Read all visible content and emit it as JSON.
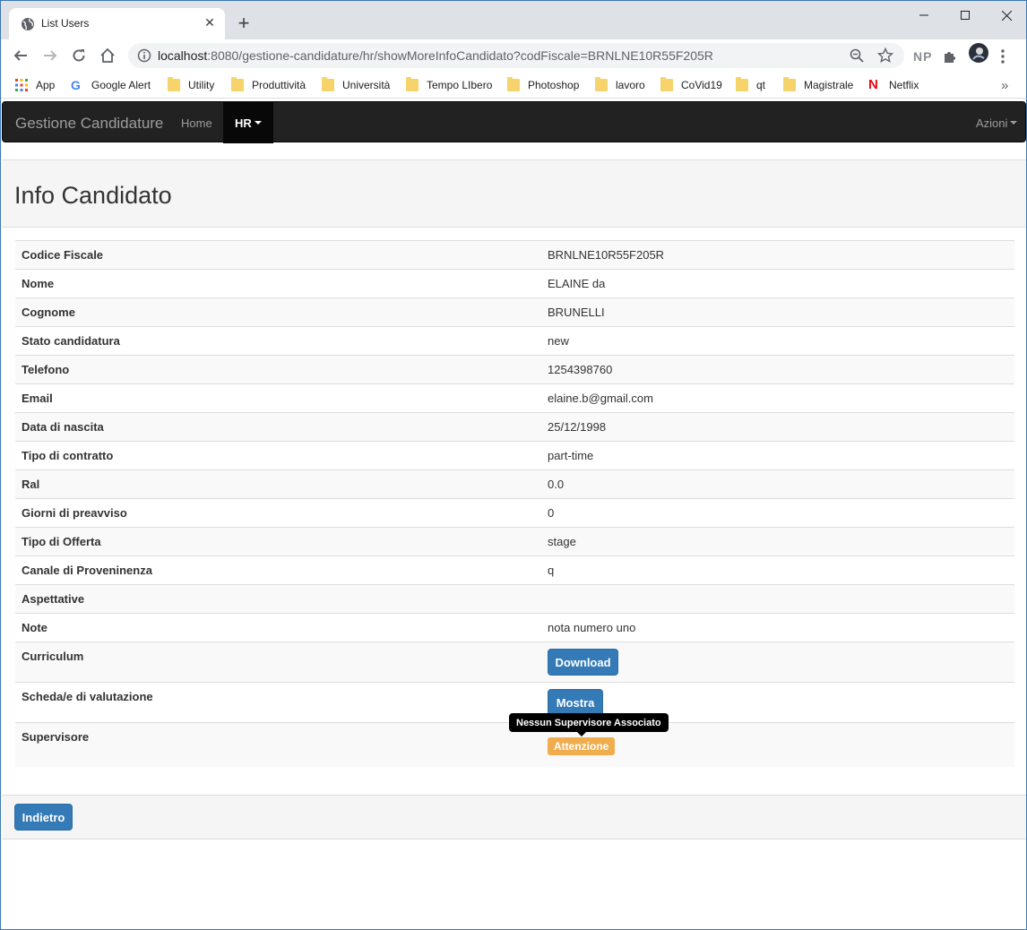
{
  "browser": {
    "tab_title": "List Users",
    "url_host": "localhost",
    "url_rest": ":8080/gestione-candidature/hr/showMoreInfoCandidato?codFiscale=BRNLNE10R55F205R",
    "extension_np": "NP",
    "bookmarks": [
      {
        "label": "App",
        "icon": "apps-grid-icon"
      },
      {
        "label": "Google Alert",
        "icon": "google-icon"
      },
      {
        "label": "Utility",
        "icon": "folder-icon"
      },
      {
        "label": "Produttività",
        "icon": "folder-icon"
      },
      {
        "label": "Università",
        "icon": "folder-icon"
      },
      {
        "label": "Tempo LIbero",
        "icon": "folder-icon"
      },
      {
        "label": "Photoshop",
        "icon": "folder-icon"
      },
      {
        "label": "lavoro",
        "icon": "folder-icon"
      },
      {
        "label": "CoVid19",
        "icon": "folder-icon"
      },
      {
        "label": "qt",
        "icon": "folder-icon"
      },
      {
        "label": "Magistrale",
        "icon": "folder-icon"
      },
      {
        "label": "Netflix",
        "icon": "netflix-icon"
      }
    ],
    "bookmarks_overflow": "»"
  },
  "navbar": {
    "brand": "Gestione Candidature",
    "home": "Home",
    "hr": "HR",
    "azioni": "Azioni"
  },
  "panel": {
    "title": "Info Candidato"
  },
  "fields": [
    {
      "label": "Codice Fiscale",
      "value": "BRNLNE10R55F205R"
    },
    {
      "label": "Nome",
      "value": "ELAINE da"
    },
    {
      "label": "Cognome",
      "value": "BRUNELLI"
    },
    {
      "label": "Stato candidatura",
      "value": "new"
    },
    {
      "label": "Telefono",
      "value": "1254398760"
    },
    {
      "label": "Email",
      "value": "elaine.b@gmail.com"
    },
    {
      "label": "Data di nascita",
      "value": "25/12/1998"
    },
    {
      "label": "Tipo di contratto",
      "value": "part-time"
    },
    {
      "label": "Ral",
      "value": "0.0"
    },
    {
      "label": "Giorni di preavviso",
      "value": "0"
    },
    {
      "label": "Tipo di Offerta",
      "value": "stage"
    },
    {
      "label": "Canale di Proveninenza",
      "value": "q"
    },
    {
      "label": "Aspettative",
      "value": ""
    },
    {
      "label": "Note",
      "value": "nota numero uno"
    }
  ],
  "curriculum": {
    "label": "Curriculum",
    "button": "Download"
  },
  "schede": {
    "label": "Scheda/e di valutazione",
    "button": "Mostra"
  },
  "supervisore": {
    "label": "Supervisore",
    "badge": "Attenzione",
    "tooltip": "Nessun Supervisore Associato"
  },
  "footer": {
    "back_button": "Indietro"
  },
  "colors": {
    "primary": "#337ab7",
    "warning": "#f0ad4e",
    "navbar": "#222222"
  }
}
